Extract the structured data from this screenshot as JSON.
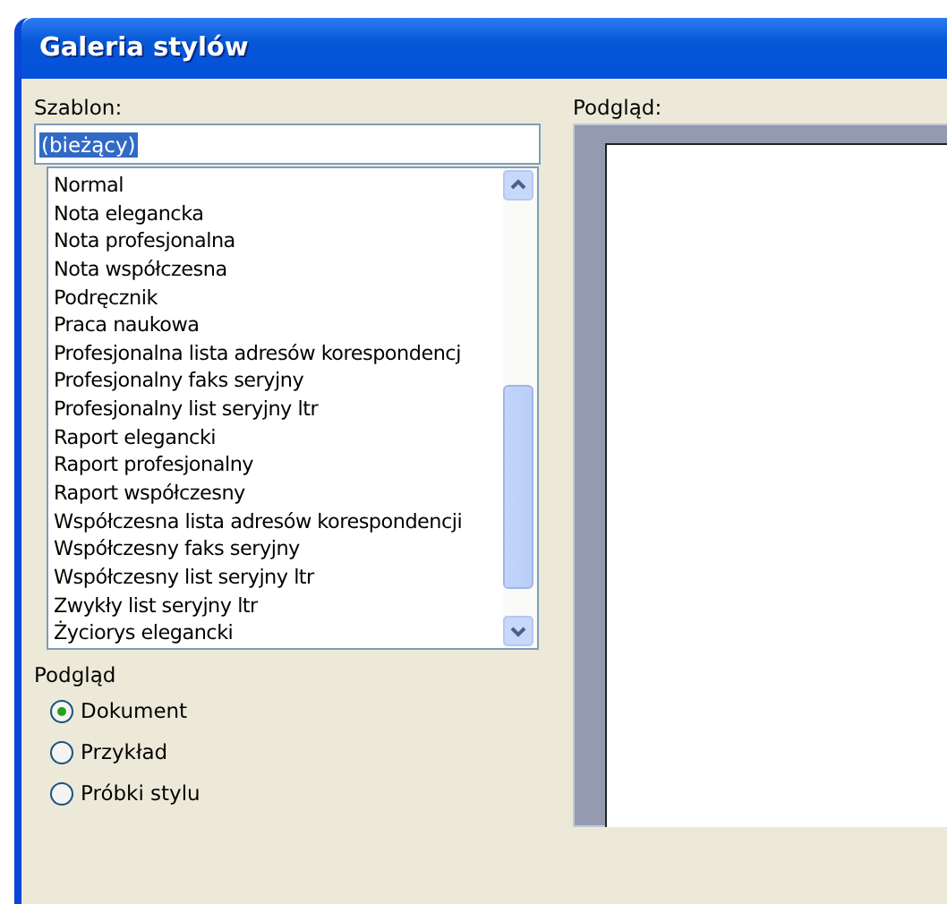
{
  "window": {
    "title": "Galeria stylów"
  },
  "template": {
    "label": "Szablon:",
    "value": "(bieżący)",
    "value_selected": true,
    "items": [
      {
        "label": "Normal",
        "selected": false
      },
      {
        "label": "Nota elegancka",
        "selected": false
      },
      {
        "label": "Nota profesjonalna",
        "selected": false
      },
      {
        "label": "Nota współczesna",
        "selected": false
      },
      {
        "label": "Podręcznik",
        "selected": false
      },
      {
        "label": "Praca naukowa",
        "selected": false
      },
      {
        "label": "Profesjonalna lista adresów korespondencj",
        "selected": false
      },
      {
        "label": "Profesjonalny faks seryjny",
        "selected": false
      },
      {
        "label": "Profesjonalny list seryjny ltr",
        "selected": false
      },
      {
        "label": "Raport elegancki",
        "selected": false
      },
      {
        "label": "Raport profesjonalny",
        "selected": false
      },
      {
        "label": "Raport współczesny",
        "selected": false
      },
      {
        "label": "Współczesna lista adresów korespondencji",
        "selected": false
      },
      {
        "label": "Współczesny faks seryjny",
        "selected": false
      },
      {
        "label": "Współczesny list seryjny ltr",
        "selected": false
      },
      {
        "label": "Zwykły list seryjny ltr",
        "selected": false
      },
      {
        "label": "Życiorys elegancki",
        "selected": false
      }
    ]
  },
  "preview_options": {
    "label": "Podgląd",
    "options": [
      {
        "label": "Dokument",
        "selected": true
      },
      {
        "label": "Przykład",
        "selected": false
      },
      {
        "label": "Próbki stylu",
        "selected": false
      }
    ]
  },
  "preview": {
    "label": "Podgląd:"
  }
}
